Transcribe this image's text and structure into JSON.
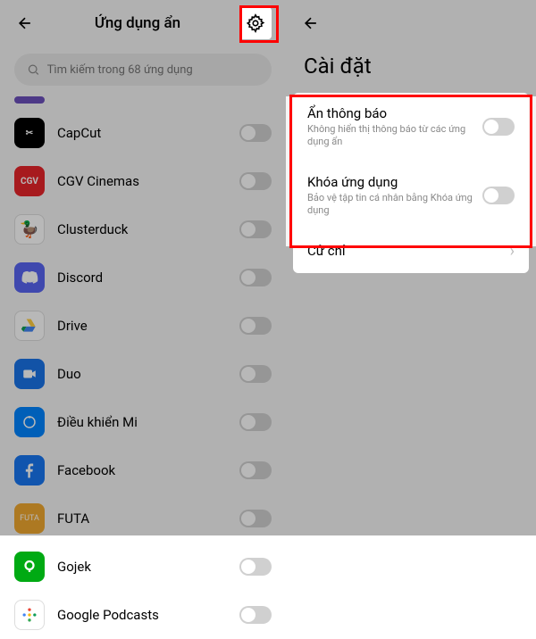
{
  "left": {
    "title": "Ứng dụng ẩn",
    "search_placeholder": "Tìm kiếm trong 68 ứng dụng",
    "apps": [
      {
        "name": "CapCut"
      },
      {
        "name": "CGV Cinemas"
      },
      {
        "name": "Clusterduck"
      },
      {
        "name": "Discord"
      },
      {
        "name": "Drive"
      },
      {
        "name": "Duo"
      },
      {
        "name": "Điều khiển Mi"
      },
      {
        "name": "Facebook"
      },
      {
        "name": "FUTA"
      },
      {
        "name": "Gojek"
      },
      {
        "name": "Google Podcasts"
      }
    ]
  },
  "right": {
    "title": "Cài đặt",
    "rows": [
      {
        "label": "Ẩn thông báo",
        "desc": "Không hiển thị thông báo từ các ứng dụng ẩn"
      },
      {
        "label": "Khóa ứng dụng",
        "desc": "Bảo vệ tập tin cá nhân bằng Khóa ứng dụng"
      },
      {
        "label": "Cử chỉ"
      }
    ]
  }
}
